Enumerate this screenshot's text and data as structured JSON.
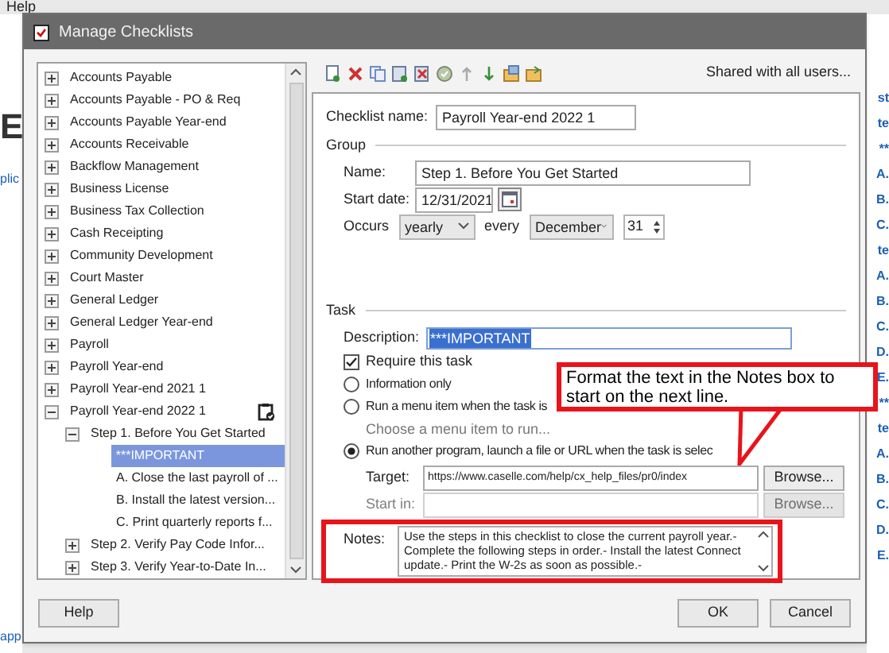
{
  "background_app": {
    "menu": "Help",
    "left_fragments": [
      "E",
      "plic",
      "app"
    ],
    "right_fragments": [
      "st",
      "te",
      "**",
      "A.",
      "B.",
      "C.",
      "te",
      "A.",
      "B.",
      "C.",
      "D.",
      "E.",
      "**",
      "te",
      "A.",
      "B.",
      "C.",
      "D.",
      "E."
    ]
  },
  "window": {
    "title": "Manage Checklists"
  },
  "tree": {
    "items": [
      {
        "label": "Accounts Payable",
        "expanded": false,
        "selected": false
      },
      {
        "label": "Accounts Payable - PO & Req",
        "expanded": false,
        "selected": false
      },
      {
        "label": "Accounts Payable Year-end",
        "expanded": false,
        "selected": false
      },
      {
        "label": "Accounts Receivable",
        "expanded": false,
        "selected": false
      },
      {
        "label": "Backflow Management",
        "expanded": false,
        "selected": false
      },
      {
        "label": "Business License",
        "expanded": false,
        "selected": false
      },
      {
        "label": "Business Tax Collection",
        "expanded": false,
        "selected": false
      },
      {
        "label": "Cash Receipting",
        "expanded": false,
        "selected": false
      },
      {
        "label": "Community Development",
        "expanded": false,
        "selected": false
      },
      {
        "label": "Court Master",
        "expanded": false,
        "selected": false
      },
      {
        "label": "General Ledger",
        "expanded": false,
        "selected": false
      },
      {
        "label": "General Ledger Year-end",
        "expanded": false,
        "selected": false
      },
      {
        "label": "Payroll",
        "expanded": false,
        "selected": false
      },
      {
        "label": "Payroll Year-end",
        "expanded": false,
        "selected": false
      },
      {
        "label": "Payroll Year-end 2021 1",
        "expanded": false,
        "selected": false
      },
      {
        "label": "Payroll Year-end 2022 1",
        "expanded": true,
        "selected": false,
        "children": [
          {
            "label": "Step 1. Before You Get Started",
            "expanded": true,
            "selected": false,
            "children": [
              {
                "label": "***IMPORTANT",
                "selected": true
              },
              {
                "label": "A. Close the last payroll of ...",
                "selected": false
              },
              {
                "label": "B. Install the latest version...",
                "selected": false
              },
              {
                "label": "C. Print quarterly reports f...",
                "selected": false
              }
            ]
          },
          {
            "label": "Step 2. Verify Pay Code Infor...",
            "expanded": false,
            "selected": false
          },
          {
            "label": "Step 3. Verify Year-to-Date In...",
            "expanded": false,
            "selected": false
          }
        ]
      }
    ]
  },
  "toolbar": {
    "shared_link": "Shared with all users..."
  },
  "form": {
    "checklist_name_label": "Checklist name:",
    "checklist_name": "Payroll Year-end 2022 1",
    "group": {
      "heading": "Group",
      "name_label": "Name:",
      "name": "Step 1. Before You Get Started",
      "start_date_label": "Start date:",
      "start_date": "12/31/2021",
      "occurs_label": "Occurs",
      "occurs": "yearly",
      "every_label": "every",
      "month": "December",
      "day": "31"
    },
    "task": {
      "heading": "Task",
      "description_label": "Description:",
      "description": "***IMPORTANT",
      "require": {
        "label": "Require this task",
        "checked": true
      },
      "options": [
        {
          "label": "Information only",
          "selected": false
        },
        {
          "label": "Run a menu item when the task is",
          "selected": false
        },
        {
          "label": "Run another program, launch a file or URL when the task is selec",
          "selected": true
        }
      ],
      "menu_item_hint": "Choose a menu item to run...",
      "target_label": "Target:",
      "target": "https://www.caselle.com/help/cx_help_files/pr0/index",
      "start_in_label": "Start in:",
      "browse_buttons": [
        {
          "label": "Browse...",
          "disabled": false
        },
        {
          "label": "Browse...",
          "disabled": true
        }
      ],
      "notes_label": "Notes:",
      "notes": "Use the steps in this checklist to close the current payroll year.- Complete the following steps in order.- Install the latest Connect update.- Print the W-2s as soon as possible.-"
    }
  },
  "buttons": {
    "help": "Help",
    "ok": "OK",
    "cancel": "Cancel"
  },
  "annotation": {
    "text": "Format the text in the Notes box to start on the next line."
  }
}
